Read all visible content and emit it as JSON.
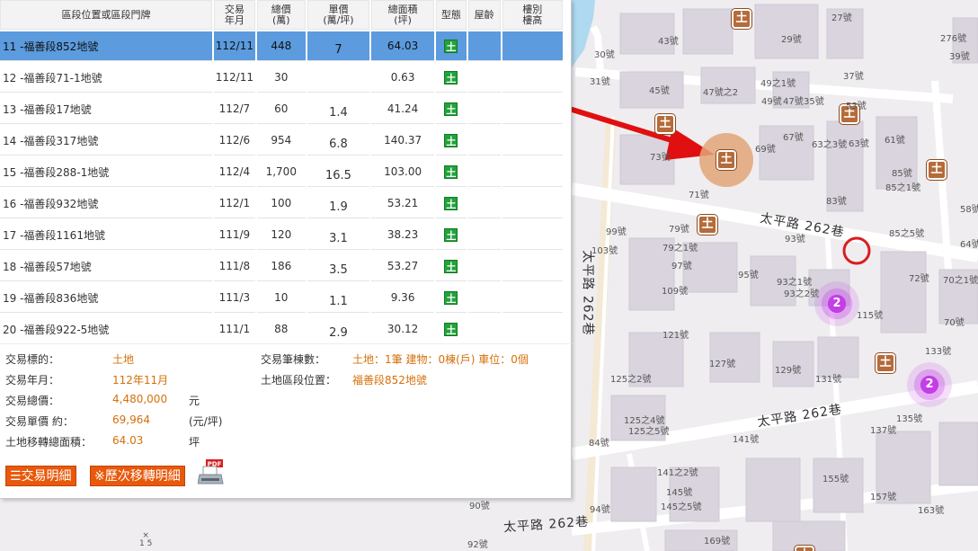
{
  "table": {
    "headers": {
      "location": "區段位置或區段門牌",
      "date": [
        "交易",
        "年月"
      ],
      "total": [
        "總價",
        "(萬)"
      ],
      "unit": [
        "單價",
        "(萬/坪)"
      ],
      "area": [
        "總面積",
        "(坪)"
      ],
      "type": "型態",
      "age": "屋齡",
      "floor": [
        "樓別",
        "樓高"
      ]
    },
    "rows": [
      {
        "loc": "11 -福善段852地號",
        "date": "112/11",
        "total": "448",
        "unit": "7",
        "area": "64.03",
        "type": "土"
      },
      {
        "loc": "12 -福善段71-1地號",
        "date": "112/11",
        "total": "30",
        "unit": "",
        "area": "0.63",
        "type": "土"
      },
      {
        "loc": "13 -福善段17地號",
        "date": "112/7",
        "total": "60",
        "unit": "1.4",
        "area": "41.24",
        "type": "土"
      },
      {
        "loc": "14 -福善段317地號",
        "date": "112/6",
        "total": "954",
        "unit": "6.8",
        "area": "140.37",
        "type": "土"
      },
      {
        "loc": "15 -福善段288-1地號",
        "date": "112/4",
        "total": "1,700",
        "unit": "16.5",
        "area": "103.00",
        "type": "土"
      },
      {
        "loc": "16 -福善段932地號",
        "date": "112/1",
        "total": "100",
        "unit": "1.9",
        "area": "53.21",
        "type": "土"
      },
      {
        "loc": "17 -福善段1161地號",
        "date": "111/9",
        "total": "120",
        "unit": "3.1",
        "area": "38.23",
        "type": "土"
      },
      {
        "loc": "18 -福善段57地號",
        "date": "111/8",
        "total": "186",
        "unit": "3.5",
        "area": "53.27",
        "type": "土"
      },
      {
        "loc": "19 -福善段836地號",
        "date": "111/3",
        "total": "10",
        "unit": "1.1",
        "area": "9.36",
        "type": "土"
      },
      {
        "loc": "20 -福善段922-5地號",
        "date": "111/1",
        "total": "88",
        "unit": "2.9",
        "area": "30.12",
        "type": "土"
      }
    ]
  },
  "detail": {
    "target_label": "交易標的：",
    "target_value": "土地",
    "date_label": "交易年月：",
    "date_value": "112年11月",
    "total_label": "交易總價：",
    "total_value": "4,480,000",
    "total_unit": "元",
    "unit_label": "交易單價 約：",
    "unit_value": "69,964",
    "unit_unit": "(元/坪)",
    "area_label": "土地移轉總面積：",
    "area_value": "64.03",
    "area_unit": "坪",
    "count_label": "交易筆棟數：",
    "count_value": "土地：1筆 建物：0棟(戶) 車位：0個",
    "section_label": "土地區段位置：",
    "section_value": "福善段852地號"
  },
  "buttons": {
    "detail": "☰交易明細",
    "history": "※歷次移轉明細",
    "pdf_badge": "PDF"
  },
  "map": {
    "roads": [
      "太平路 262巷",
      "太平路 262巷",
      "太平路 262巷",
      "太平路 262巷"
    ],
    "marker_glyph": "土",
    "clusters": [
      "2",
      "2"
    ],
    "labels": [
      "27號",
      "276號",
      "29號",
      "43號",
      "30號",
      "31號",
      "45號",
      "47號之2",
      "49之1號",
      "49號",
      "47號",
      "35號",
      "37號",
      "39號",
      "53號",
      "67號",
      "63之3號",
      "63號",
      "61號",
      "69號",
      "73號",
      "85號",
      "85之1號",
      "83號",
      "71號",
      "58號",
      "99號",
      "79號",
      "79之1號",
      "103號",
      "97號",
      "93號",
      "85之5號",
      "64號",
      "95號",
      "93之1號",
      "93之2號",
      "72號",
      "70之1號",
      "109號",
      "115號",
      "70號",
      "121號",
      "133號",
      "127號",
      "129號",
      "131號",
      "125之2號",
      "125之4號",
      "125之5號",
      "135號",
      "141號",
      "137號",
      "84號",
      "141之2號",
      "145號",
      "145之5號",
      "155號",
      "157號",
      "163號",
      "90號",
      "94號",
      "92號",
      "169號"
    ]
  },
  "corner": {
    "x": "×",
    "num": "1 5"
  }
}
